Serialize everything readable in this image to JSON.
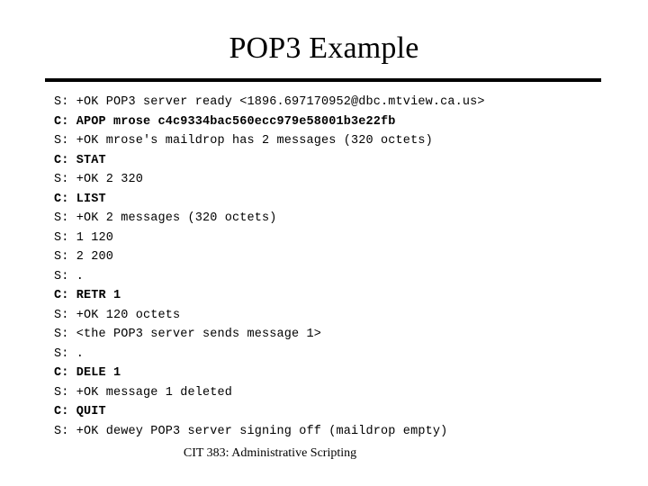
{
  "slide": {
    "title": "POP3 Example",
    "footer": "CIT 383: Administrative Scripting"
  },
  "transcript": {
    "lines": [
      {
        "role": "S",
        "prefix": "S:",
        "text": "+OK POP3 server ready <1896.697170952@dbc.mtview.ca.us>",
        "full": "S: +OK POP3 server ready <1896.697170952@dbc.mtview.ca.us>",
        "bold": false
      },
      {
        "role": "C",
        "prefix": "C:",
        "text": "APOP mrose c4c9334bac560ecc979e58001b3e22fb",
        "full": "C: APOP mrose c4c9334bac560ecc979e58001b3e22fb",
        "bold": true
      },
      {
        "role": "S",
        "prefix": "S:",
        "text": "+OK mrose's maildrop has 2 messages (320 octets)",
        "full": "S: +OK mrose's maildrop has 2 messages (320 octets)",
        "bold": false
      },
      {
        "role": "C",
        "prefix": "C:",
        "text": "STAT",
        "full": "C: STAT",
        "bold": true
      },
      {
        "role": "S",
        "prefix": "S:",
        "text": "+OK 2 320",
        "full": "S: +OK 2 320",
        "bold": false
      },
      {
        "role": "C",
        "prefix": "C:",
        "text": "LIST",
        "full": "C: LIST",
        "bold": true
      },
      {
        "role": "S",
        "prefix": "S:",
        "text": "+OK 2 messages (320 octets)",
        "full": "S: +OK 2 messages (320 octets)",
        "bold": false
      },
      {
        "role": "S",
        "prefix": "S:",
        "text": "1 120",
        "full": "S: 1 120",
        "bold": false
      },
      {
        "role": "S",
        "prefix": "S:",
        "text": "2 200",
        "full": "S: 2 200",
        "bold": false
      },
      {
        "role": "S",
        "prefix": "S:",
        "text": ".",
        "full": "S: .",
        "bold": false
      },
      {
        "role": "C",
        "prefix": "C:",
        "text": "RETR 1",
        "full": "C: RETR 1",
        "bold": true
      },
      {
        "role": "S",
        "prefix": "S:",
        "text": "+OK 120 octets",
        "full": "S: +OK 120 octets",
        "bold": false
      },
      {
        "role": "S",
        "prefix": "S:",
        "text": "<the POP3 server sends message 1>",
        "full": "S: <the POP3 server sends message 1>",
        "bold": false
      },
      {
        "role": "S",
        "prefix": "S:",
        "text": ".",
        "full": "S: .",
        "bold": false
      },
      {
        "role": "C",
        "prefix": "C:",
        "text": "DELE 1",
        "full": "C: DELE 1",
        "bold": true
      },
      {
        "role": "S",
        "prefix": "S:",
        "text": "+OK message 1 deleted",
        "full": "S: +OK message 1 deleted",
        "bold": false
      },
      {
        "role": "C",
        "prefix": "C:",
        "text": "QUIT",
        "full": "C: QUIT",
        "bold": true
      },
      {
        "role": "S",
        "prefix": "S:",
        "text": "+OK dewey POP3 server signing off (maildrop empty)",
        "full": "S: +OK dewey POP3 server signing off (maildrop empty)",
        "bold": false
      }
    ]
  },
  "colors": {
    "background": "#ffffff",
    "text": "#000000",
    "rule": "#000000"
  }
}
